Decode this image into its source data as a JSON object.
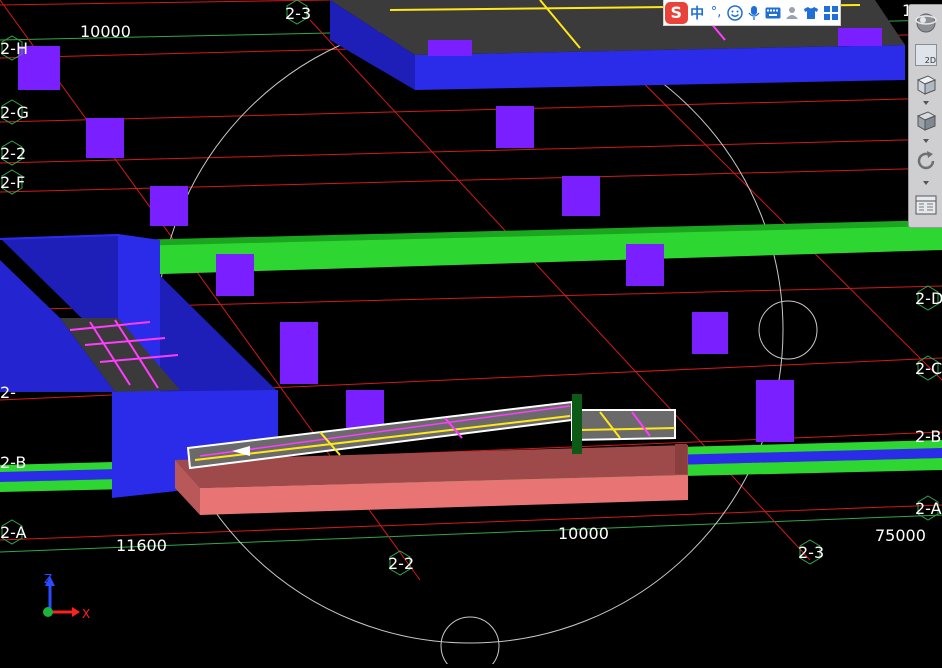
{
  "viewport": {
    "grid_labels": {
      "top_row": [
        "2-3"
      ],
      "left_column": [
        "2-H",
        "2-G",
        "2-2",
        "2-F",
        "2-",
        "2-B",
        "2-A"
      ],
      "right_column": [
        "2-D",
        "2-C",
        "2-B",
        "2-A"
      ],
      "bottom_row": [
        "2-2",
        "2-3"
      ],
      "top_right_partial": "1"
    },
    "dimensions": {
      "top_left": "10000",
      "bottom_left": "11600",
      "bottom_middle": "10000",
      "bottom_right": "75000"
    },
    "axis_triad": {
      "z_label": "Z",
      "x_label": "X"
    },
    "colors": {
      "background": "#000000",
      "grid_line_red": "#d11a1a",
      "grid_line_green": "#2fa84a",
      "column": "#7a1fff",
      "beam_green": "#2ed632",
      "slab_blue": "#2b2bea",
      "foundation_pink": "#e87474",
      "orbit_circle": "#c8c8c8",
      "highlight_magenta": "#ff3cff",
      "highlight_yellow": "#ffe81a"
    }
  },
  "ime_toolbar": {
    "logo": "S",
    "lang": "中",
    "punct": "°,",
    "icons": [
      "smile-icon",
      "microphone-icon",
      "keyboard-icon",
      "user-icon",
      "shirt-icon",
      "grid-icon"
    ]
  },
  "view_toolbar": {
    "items": [
      {
        "name": "orbit-sphere-icon"
      },
      {
        "name": "view-2d-icon",
        "label": "2D"
      },
      {
        "name": "view-3d-cube-icon"
      },
      {
        "name": "view-box-icon"
      },
      {
        "name": "rotate-icon"
      },
      {
        "name": "properties-panel-icon"
      }
    ]
  }
}
